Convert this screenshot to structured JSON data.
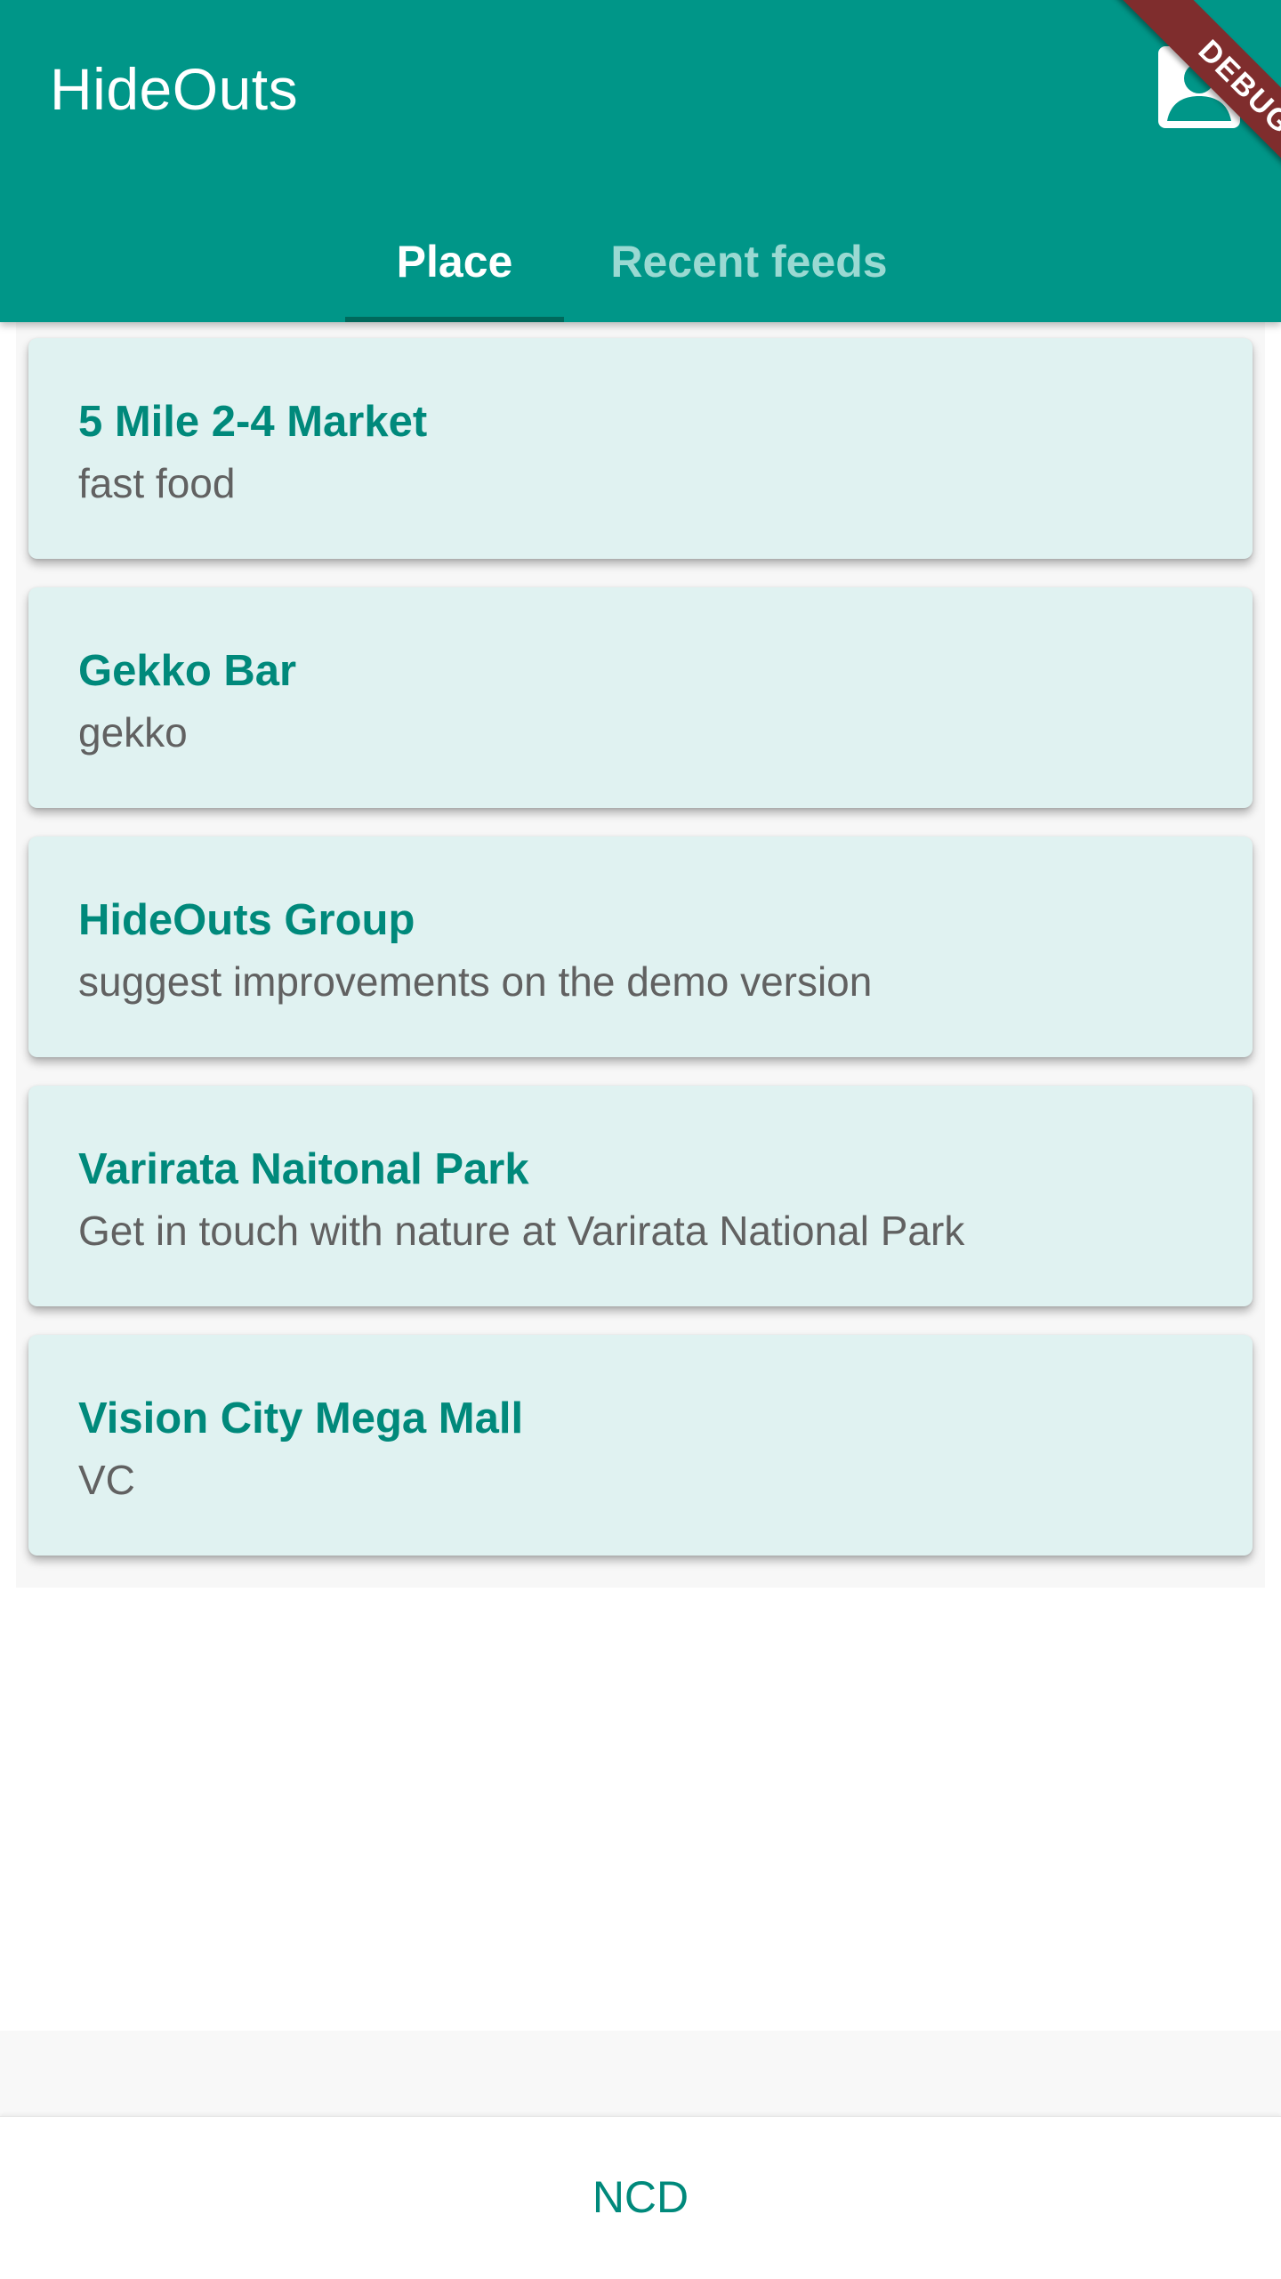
{
  "app_bar": {
    "title": "HideOuts",
    "account_icon": "account-box-icon",
    "debug_banner": "DEBUG"
  },
  "tabs": [
    {
      "label": "Place",
      "selected": true
    },
    {
      "label": "Recent feeds",
      "selected": false
    }
  ],
  "places": [
    {
      "title": "5 Mile 2-4 Market",
      "subtitle": "fast food"
    },
    {
      "title": "Gekko Bar",
      "subtitle": "gekko"
    },
    {
      "title": "HideOuts Group",
      "subtitle": "suggest improvements on the demo version"
    },
    {
      "title": "Varirata Naitonal Park",
      "subtitle": "Get in touch with nature at Varirata National Park"
    },
    {
      "title": "Vision City Mega Mall",
      "subtitle": "VC"
    }
  ],
  "bottom": {
    "button_label": "NCD"
  },
  "colors": {
    "primary": "#009688",
    "card_background": "#e0f2f1",
    "title_text": "#00897b",
    "subtitle_text": "#616161",
    "indicator": "#00695c",
    "debug_ribbon": "#7f2d2d"
  }
}
